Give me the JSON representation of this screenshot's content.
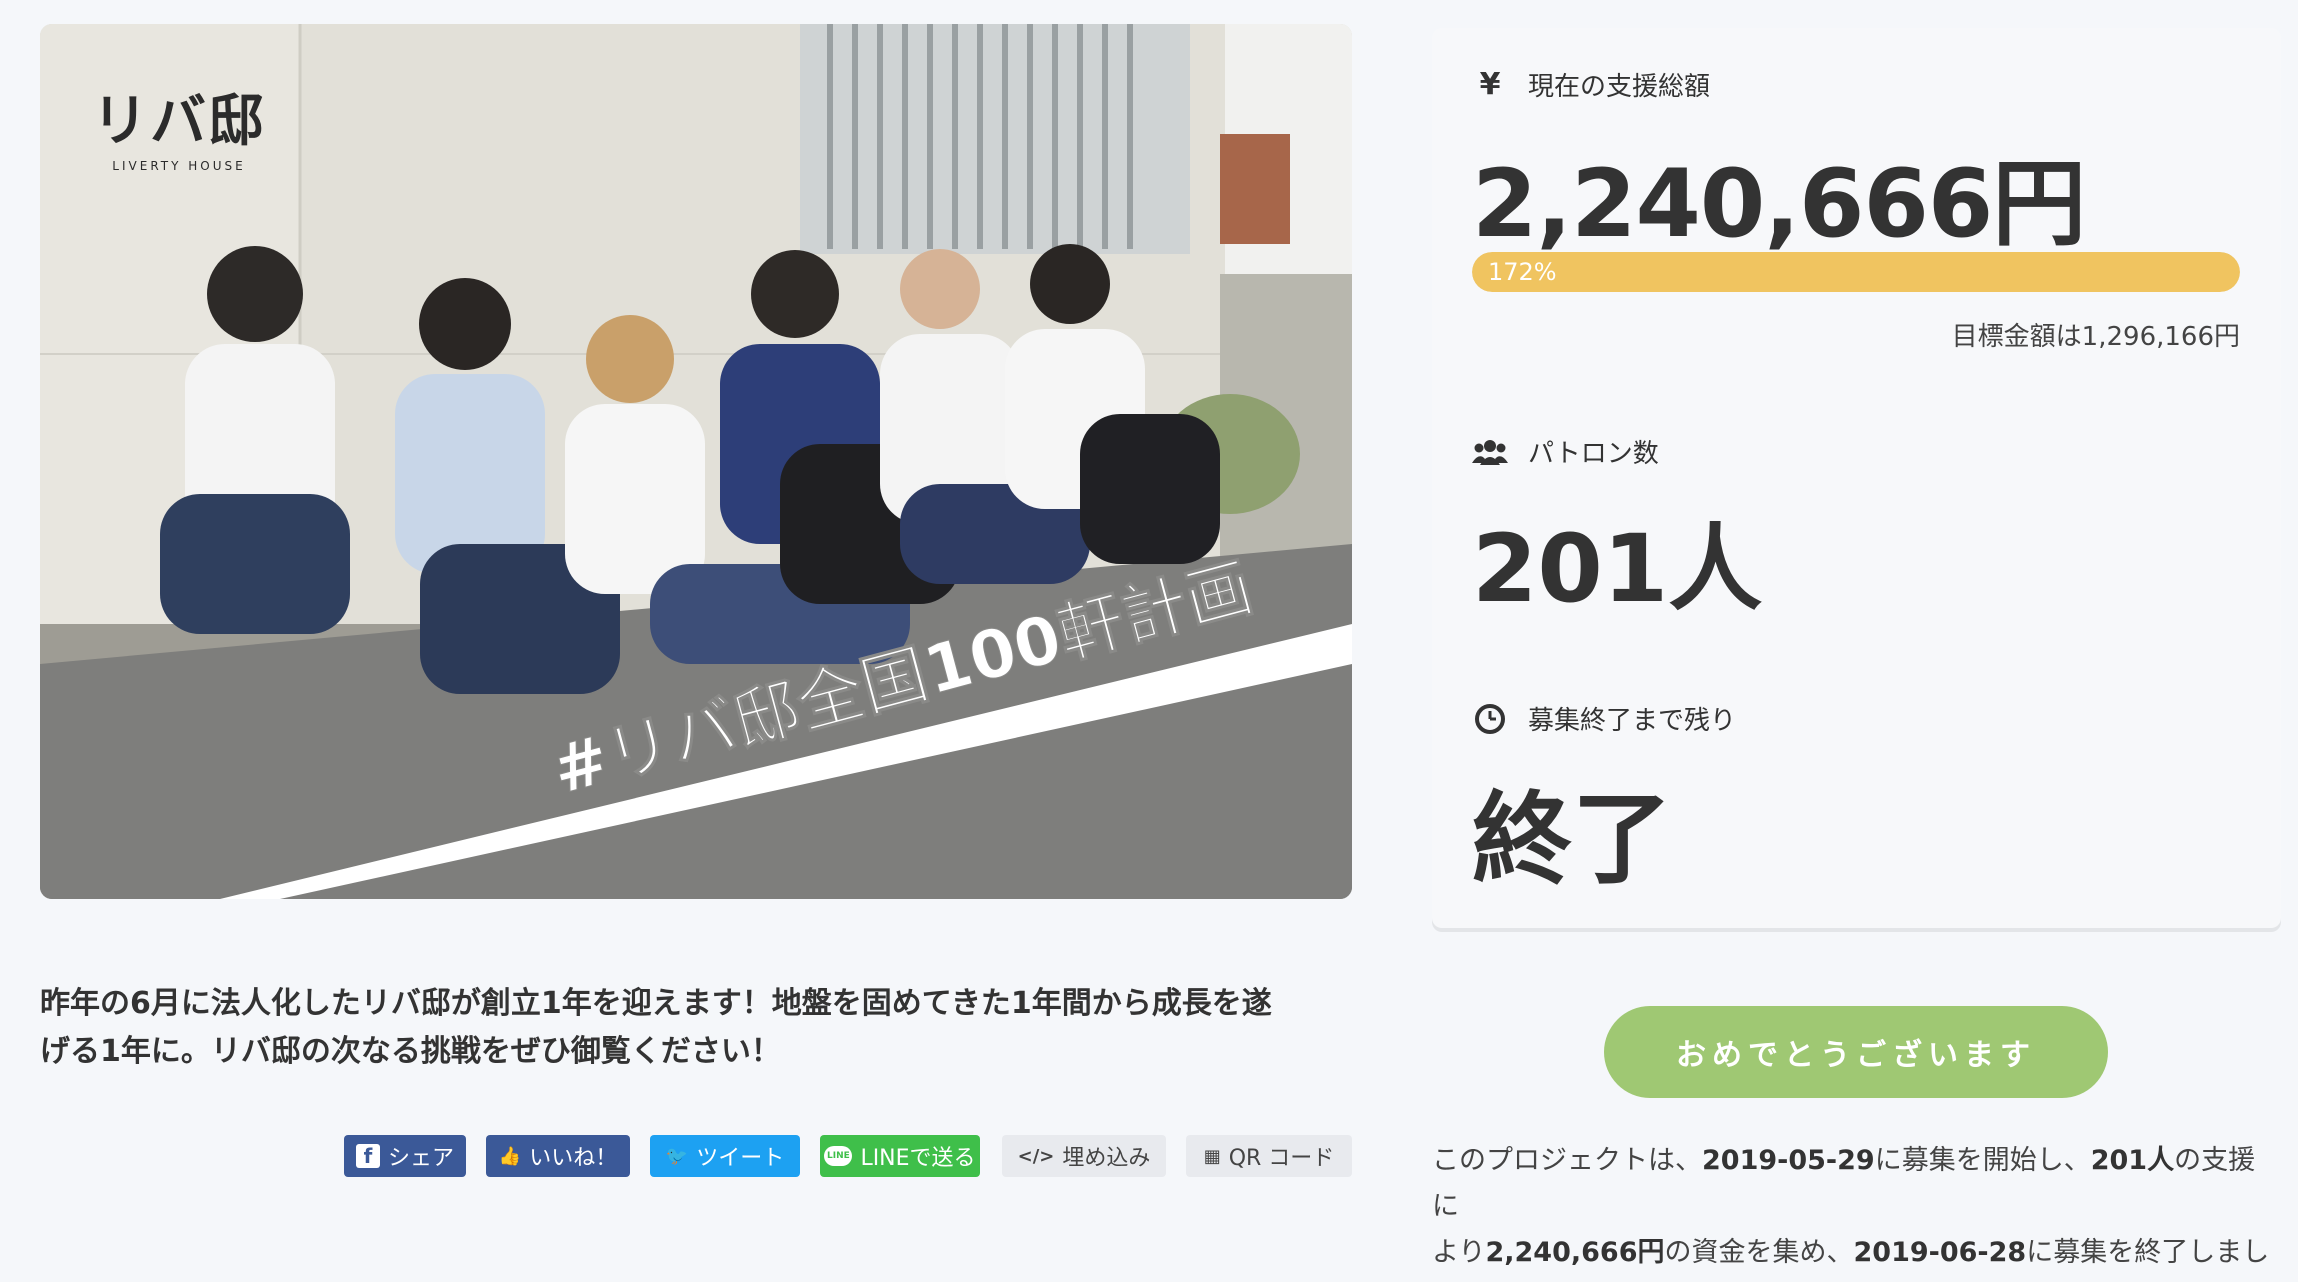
{
  "hero": {
    "logo_mark": "リバ邸",
    "logo_sub": "LIVERTY HOUSE",
    "banner_text": "#リバ邸全国100軒計画"
  },
  "description": {
    "line1": "昨年の6月に法人化したリバ邸が創立1年を迎えます！地盤を固めてきた1年間から成長を遂",
    "line2": "げる1年に。リバ邸の次なる挑戦をぜひ御覧ください！"
  },
  "share": {
    "facebook_share": "シェア",
    "facebook_like": "いいね！",
    "twitter": "ツイート",
    "line": "LINEで送る",
    "line_icon": "LINE",
    "embed": "埋め込み",
    "qr": "QR コード"
  },
  "stats": {
    "total_label": "現在の支援総額",
    "total_value": "2,240,666円",
    "progress_percent": 172,
    "progress_label": "172%",
    "goal": "目標金額は1,296,166円",
    "patron_label": "パトロン数",
    "patron_value": "201人",
    "remain_label": "募集終了まで残り",
    "remain_value": "終了"
  },
  "cta": {
    "label": "おめでとうございます"
  },
  "summary": {
    "p1": "このプロジェクトは、",
    "start": "2019-05-29",
    "p2": "に募集を開始し、",
    "patrons": "201人",
    "p3": "の支援に",
    "p4": "より",
    "amount": "2,240,666円",
    "p5": "の資金を集め、",
    "end": "2019-06-28",
    "p6": "に募集を終了しました"
  },
  "colors": {
    "progress": "#f0c460",
    "cta": "#9fc873",
    "facebook": "#3b5998",
    "twitter": "#1da1f2",
    "line": "#3fbf4a"
  }
}
